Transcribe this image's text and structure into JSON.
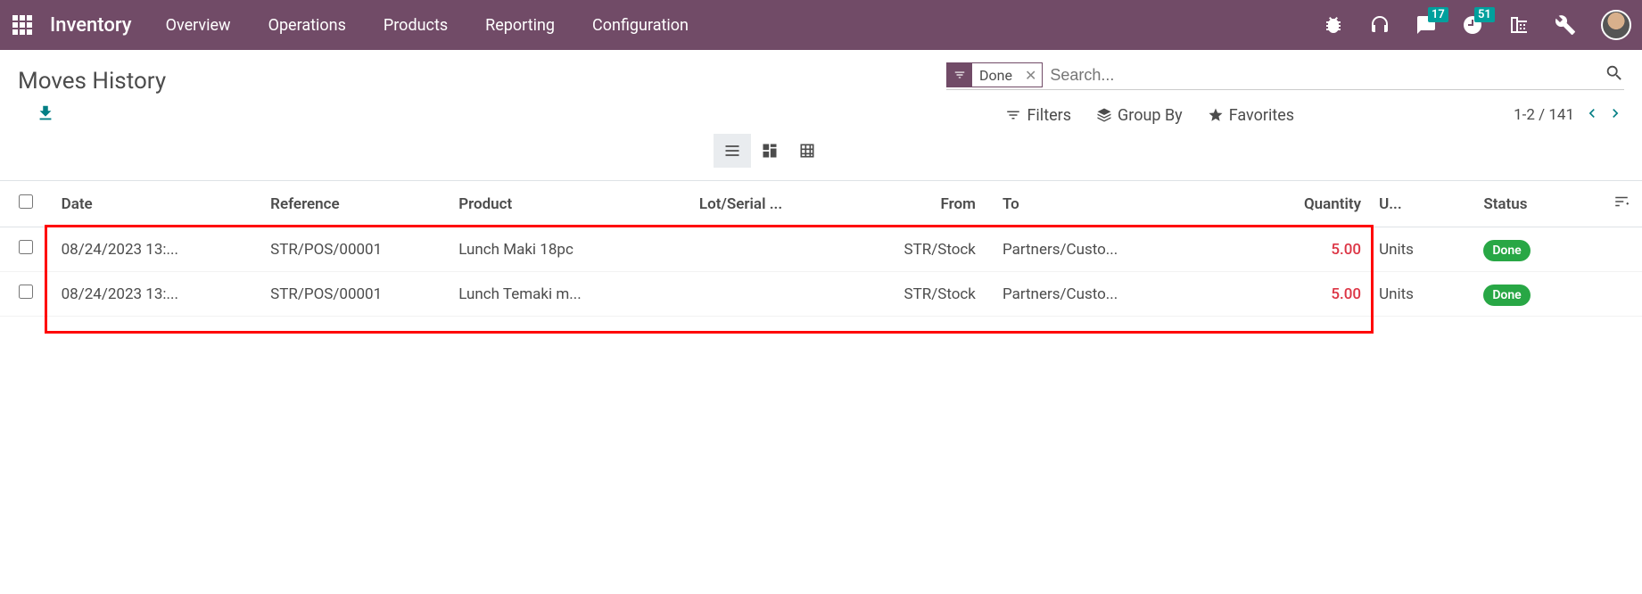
{
  "nav": {
    "brand": "Inventory",
    "menu": [
      "Overview",
      "Operations",
      "Products",
      "Reporting",
      "Configuration"
    ],
    "messaging_badge": "17",
    "activities_badge": "51"
  },
  "page": {
    "title": "Moves History",
    "filter_facet": "Done",
    "search_placeholder": "Search...",
    "filters_label": "Filters",
    "groupby_label": "Group By",
    "favorites_label": "Favorites",
    "pager": "1-2 / 141"
  },
  "table": {
    "headers": {
      "date": "Date",
      "reference": "Reference",
      "product": "Product",
      "lot": "Lot/Serial ...",
      "from": "From",
      "to": "To",
      "quantity": "Quantity",
      "uom": "U...",
      "status": "Status"
    },
    "rows": [
      {
        "date": "08/24/2023 13:...",
        "reference": "STR/POS/00001",
        "product": "Lunch Maki 18pc",
        "lot": "",
        "from": "STR/Stock",
        "to": "Partners/Custo...",
        "quantity": "5.00",
        "uom": "Units",
        "status": "Done"
      },
      {
        "date": "08/24/2023 13:...",
        "reference": "STR/POS/00001",
        "product": "Lunch Temaki m...",
        "lot": "",
        "from": "STR/Stock",
        "to": "Partners/Custo...",
        "quantity": "5.00",
        "uom": "Units",
        "status": "Done"
      }
    ]
  }
}
